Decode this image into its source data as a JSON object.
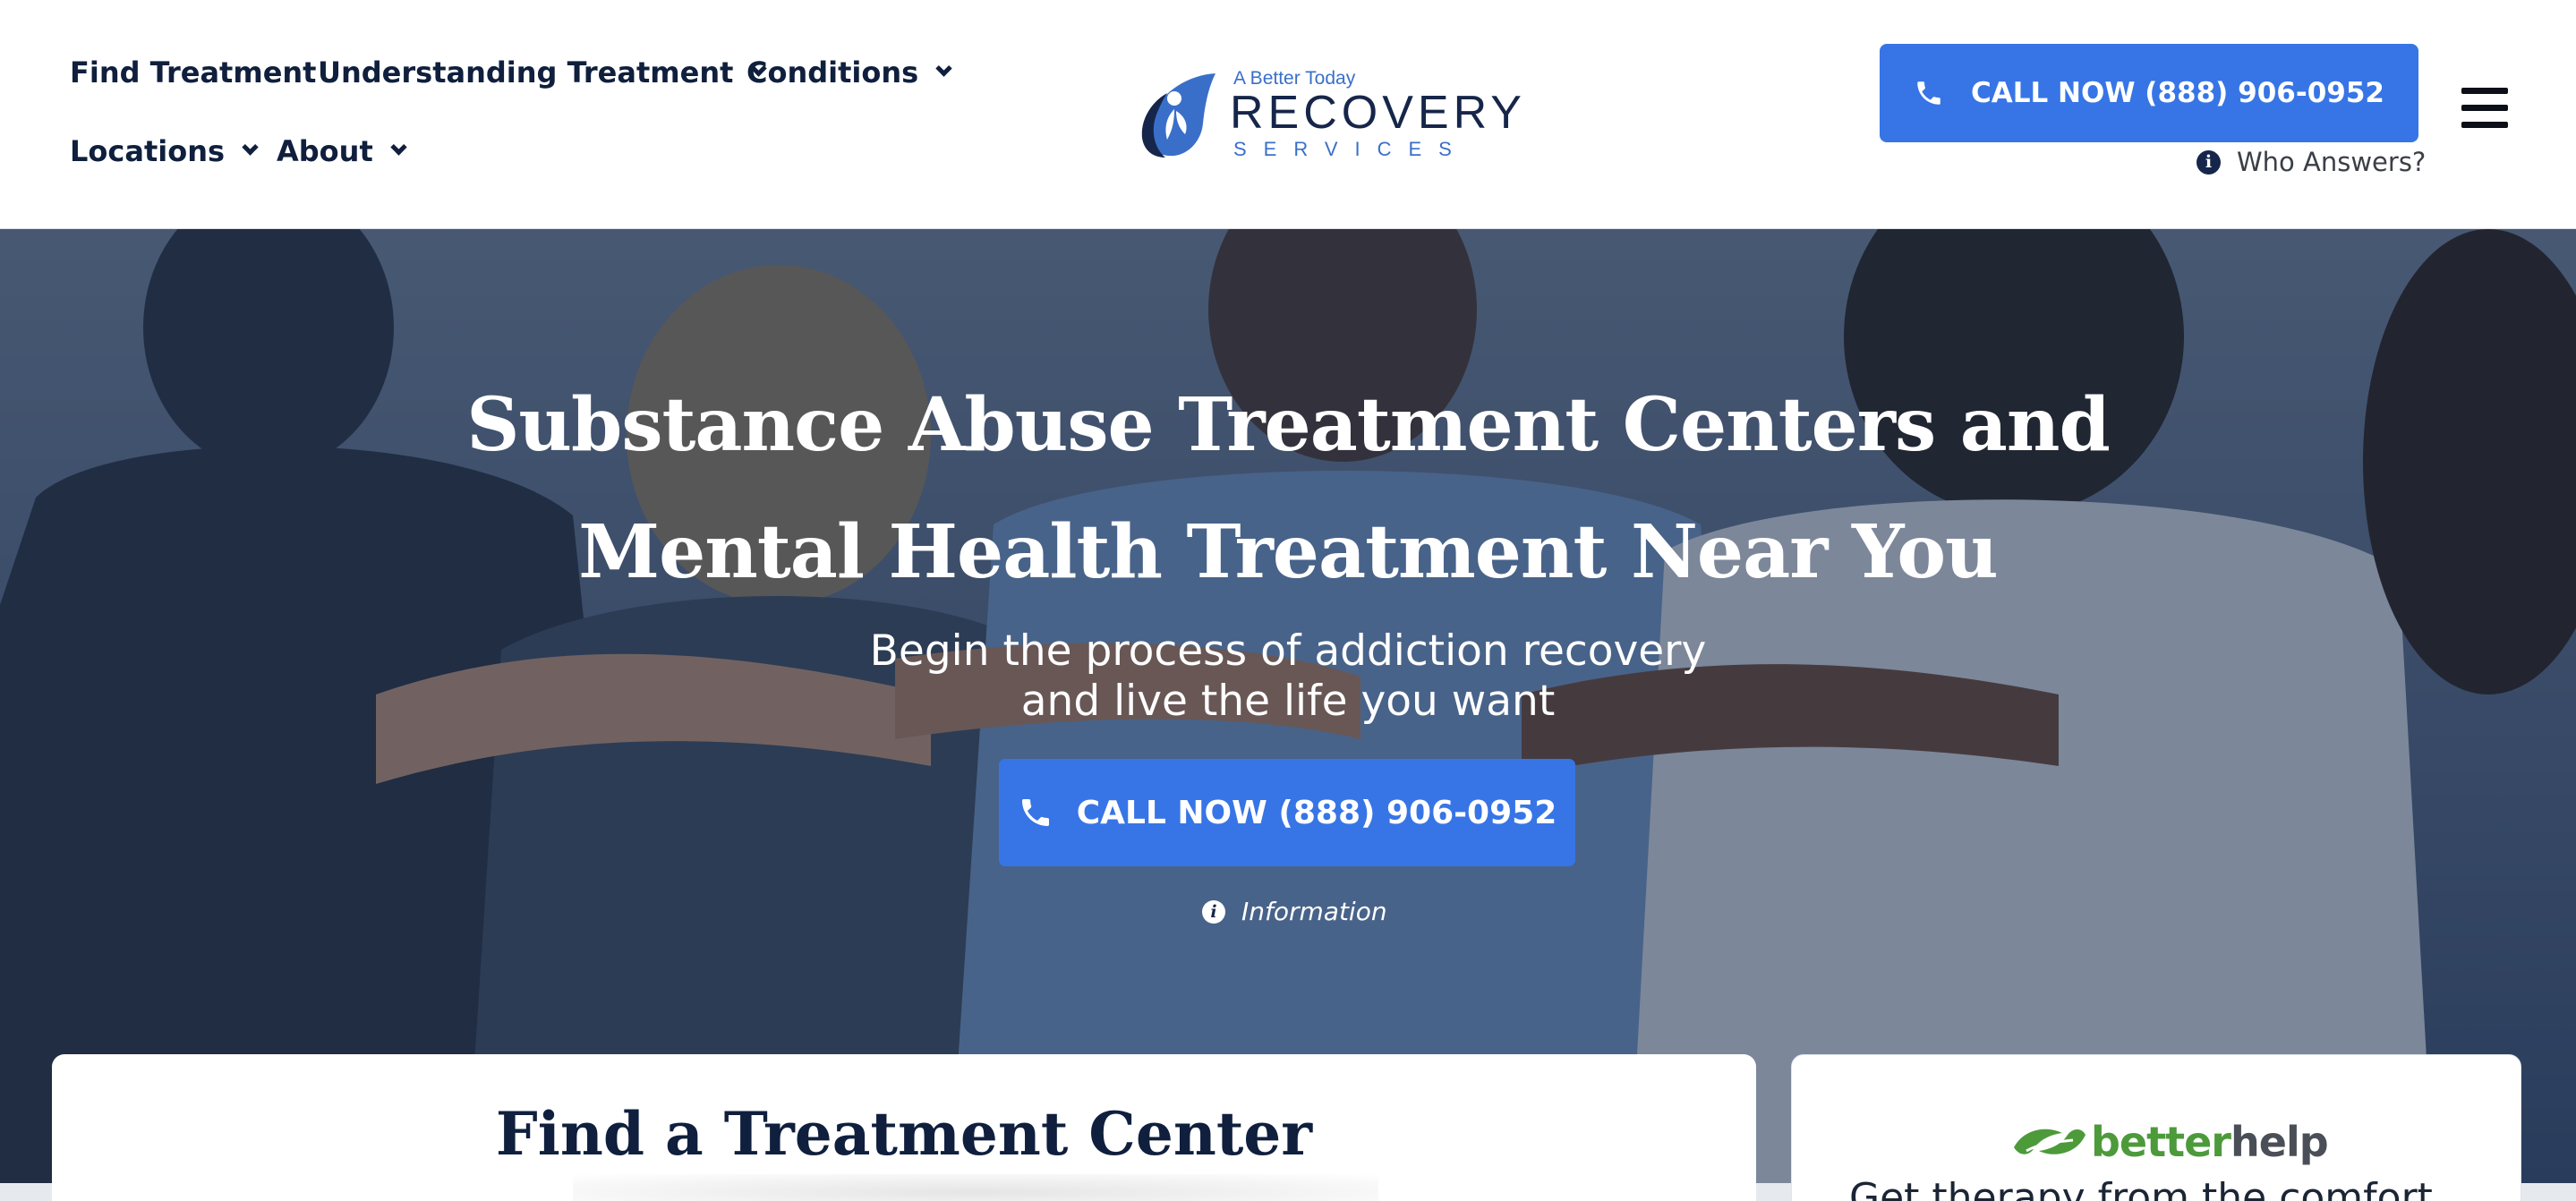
{
  "header": {
    "nav": [
      {
        "label": "Find Treatment",
        "has_dropdown": false
      },
      {
        "label": "Understanding Treatment",
        "has_dropdown": true
      },
      {
        "label": "Conditions",
        "has_dropdown": true
      },
      {
        "label": "Locations",
        "has_dropdown": true
      },
      {
        "label": "About",
        "has_dropdown": true
      }
    ],
    "logo": {
      "tagline": "A Better Today",
      "word": "RECOVERY",
      "subword": "SERVICES"
    },
    "cta_label": "CALL NOW (888) 906-0952",
    "who_answers": "Who Answers?",
    "menu_icon": "hamburger-icon"
  },
  "hero": {
    "title": "Substance Abuse Treatment Centers and Mental Health Treatment Near You",
    "subtitle_line1": "Begin the process of addiction recovery",
    "subtitle_line2": "and live the life you want",
    "cta_label": "CALL NOW (888) 906-0952",
    "info_label": "Information"
  },
  "cards": {
    "find_title": "Find a Treatment Center",
    "betterhelp": {
      "brand_part1": "better",
      "brand_part2": "help",
      "text": "Get therapy from the comfort"
    }
  },
  "colors": {
    "primary_blue": "#3775e6",
    "navy": "#0f1f3d",
    "logo_blue": "#3a6fc9",
    "betterhelp_green": "#4d9a3b"
  },
  "icons": [
    "phone-icon",
    "chevron-down-icon",
    "info-icon",
    "hamburger-icon",
    "leaf-icon"
  ]
}
